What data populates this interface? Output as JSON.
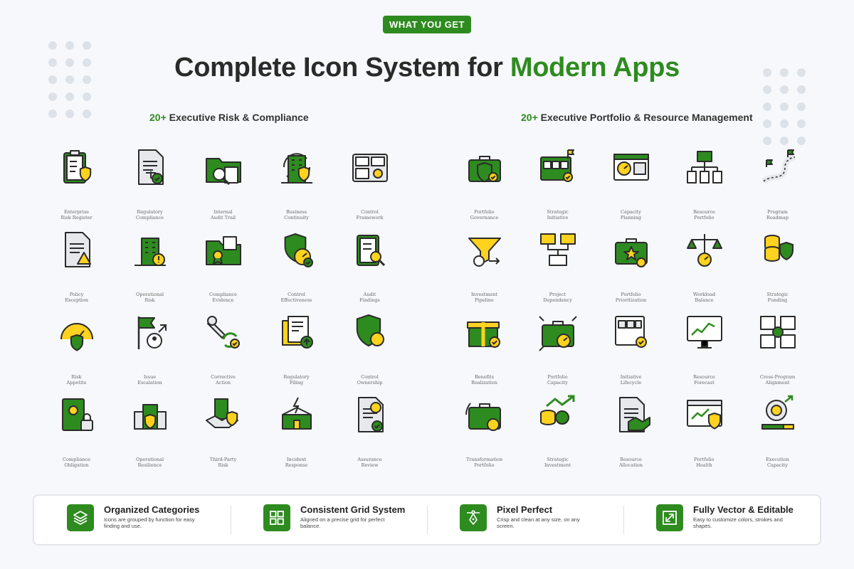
{
  "badge": "WHAT YOU GET",
  "title": {
    "main": "Complete Icon System for ",
    "accent": "Modern Apps"
  },
  "colors": {
    "primary": "#2e8b1f",
    "yellow": "#ffd21f",
    "outline": "#2b2b2b",
    "paper": "#e6e8ec"
  },
  "sections": [
    {
      "count": "20+",
      "heading": " Executive Risk & Compliance",
      "icons": [
        {
          "label": "Enterprise\nRisk Register",
          "icon": "clipboard-shield-icon"
        },
        {
          "label": "Regulatory\nCompliance",
          "icon": "document-scales-icon"
        },
        {
          "label": "Internal\nAudit Trail",
          "icon": "folder-magnifier-icon"
        },
        {
          "label": "Business\nContinuity",
          "icon": "building-cycle-shield-icon"
        },
        {
          "label": "Control\nFramework",
          "icon": "dashboard-panels-icon"
        },
        {
          "label": "Policy\nException",
          "icon": "document-warning-icon"
        },
        {
          "label": "Operational\nRisk",
          "icon": "building-warning-icon"
        },
        {
          "label": "Compliance\nEvidence",
          "icon": "folder-certificate-icon"
        },
        {
          "label": "Control\nEffectiveness",
          "icon": "shield-gauge-icon"
        },
        {
          "label": "Audit\nFindings",
          "icon": "clipboard-search-icon"
        },
        {
          "label": "Risk\nAppetite",
          "icon": "gauge-shield-icon"
        },
        {
          "label": "Issue\nEscalation",
          "icon": "flag-person-arrow-icon"
        },
        {
          "label": "Corrective\nAction",
          "icon": "wrench-cycle-icon"
        },
        {
          "label": "Regulatory\nFiling",
          "icon": "files-upload-icon"
        },
        {
          "label": "Control\nOwnership",
          "icon": "shield-award-icon"
        },
        {
          "label": "Compliance\nObligation",
          "icon": "book-lock-icon"
        },
        {
          "label": "Operational\nResilience",
          "icon": "buildings-shield-icon"
        },
        {
          "label": "Third-Party\nRisk",
          "icon": "handshake-shield-icon"
        },
        {
          "label": "Incident\nResponse",
          "icon": "building-lightning-icon"
        },
        {
          "label": "Assurance\nReview",
          "icon": "document-award-icon"
        }
      ]
    },
    {
      "count": "20+",
      "heading": " Executive Portfolio & Resource Management",
      "icons": [
        {
          "label": "Portfolio\nGovernance",
          "icon": "briefcase-shield-icon"
        },
        {
          "label": "Strategic\nInitiative",
          "icon": "board-flag-icon"
        },
        {
          "label": "Capacity\nPlanning",
          "icon": "browser-gauge-calendar-icon"
        },
        {
          "label": "Resource\nPortfolio",
          "icon": "briefcase-org-chart-icon"
        },
        {
          "label": "Program\nRoadmap",
          "icon": "road-flags-icon"
        },
        {
          "label": "Investment\nPipeline",
          "icon": "funnel-dollar-icon"
        },
        {
          "label": "Project\nDependency",
          "icon": "cards-connected-icon"
        },
        {
          "label": "Portfolio\nPrioritization",
          "icon": "briefcase-star-icon"
        },
        {
          "label": "Workload\nBalance",
          "icon": "scales-gauge-icon"
        },
        {
          "label": "Strategic\nFunding",
          "icon": "coins-shield-icon"
        },
        {
          "label": "Benefits\nRealization",
          "icon": "gift-check-icon"
        },
        {
          "label": "Portfolio\nCapacity",
          "icon": "briefcase-gauge-icon"
        },
        {
          "label": "Initiative\nLifecycle",
          "icon": "board-check-icon"
        },
        {
          "label": "Resource\nForecast",
          "icon": "monitor-chart-icon"
        },
        {
          "label": "Cross-Program\nAlignment",
          "icon": "boards-star-icon"
        },
        {
          "label": "Transformation\nPortfolio",
          "icon": "briefcase-cycle-star-icon"
        },
        {
          "label": "Strategic\nInvestment",
          "icon": "coins-award-arrow-icon"
        },
        {
          "label": "Resource\nAllocation",
          "icon": "document-handshake-icon"
        },
        {
          "label": "Portfolio\nHealth",
          "icon": "browser-chart-shield-icon"
        },
        {
          "label": "Execution\nCapacity",
          "icon": "gear-progress-icon"
        }
      ]
    }
  ],
  "features": [
    {
      "title": "Organized Categories",
      "desc": "Icons are grouped by function for easy finding and use.",
      "icon": "layers-icon"
    },
    {
      "title": "Consistent Grid System",
      "desc": "Aligned on a precise grid for perfect balance.",
      "icon": "grid-icon"
    },
    {
      "title": "Pixel Perfect",
      "desc": "Crisp and clean at any size, on any screen.",
      "icon": "pen-tool-icon"
    },
    {
      "title": "Fully Vector & Editable",
      "desc": "Easy to customize colors, strokes and shapes.",
      "icon": "resize-icon"
    }
  ]
}
